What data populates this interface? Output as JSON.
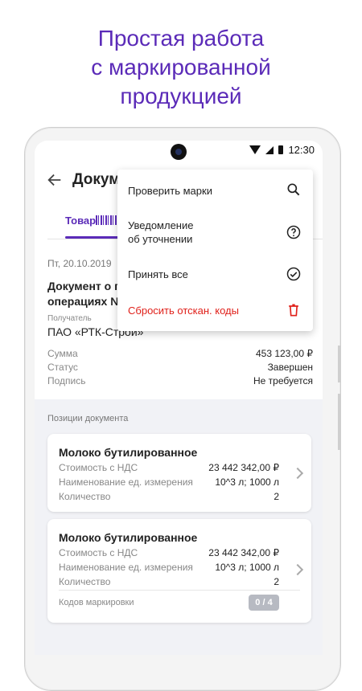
{
  "promo": {
    "line1": "Простая работа",
    "line2": "с маркированной",
    "line3": "продукцией"
  },
  "statusbar": {
    "time": "12:30"
  },
  "appbar": {
    "title": "Документ"
  },
  "tabs": {
    "active_label": "Товар"
  },
  "document": {
    "date": "Пт, 20.10.2019",
    "title_line1": "Документ о п",
    "title_line2": "операциях №",
    "recipient_label": "Получатель",
    "recipient": "ПАО «РТК-Строй»",
    "fields": [
      {
        "label": "Сумма",
        "value": "453 123,00 ₽"
      },
      {
        "label": "Статус",
        "value": "Завершен"
      },
      {
        "label": "Подпись",
        "value": "Не требуется"
      }
    ]
  },
  "positions": {
    "section_title": "Позиции документа",
    "cards": [
      {
        "title": "Молоко бутилированное",
        "rows": [
          {
            "label": "Стоимость с НДС",
            "value": "23 442 342,00 ₽"
          },
          {
            "label": "Наименование ед. измерения",
            "value": "10^3 л; 1000 л"
          },
          {
            "label": "Количество",
            "value": "2"
          }
        ]
      },
      {
        "title": "Молоко бутилированное",
        "rows": [
          {
            "label": "Стоимость с НДС",
            "value": "23 442 342,00 ₽"
          },
          {
            "label": "Наименование ед. измерения",
            "value": "10^3 л; 1000 л"
          },
          {
            "label": "Количество",
            "value": "2"
          }
        ],
        "codes_label": "Кодов маркировки",
        "codes_badge": "0 / 4"
      }
    ]
  },
  "menu": {
    "items": [
      {
        "label": "Проверить марки",
        "icon": "search-icon"
      },
      {
        "label_line1": "Уведомление",
        "label_line2": "об уточнении",
        "icon": "help-circle-icon"
      },
      {
        "label": "Принять все",
        "icon": "check-circle-icon"
      },
      {
        "label": "Сбросить отскан. коды",
        "icon": "trash-icon",
        "color": "#e0201a"
      }
    ]
  },
  "colors": {
    "accent": "#5b2bb8",
    "danger": "#e0201a"
  }
}
